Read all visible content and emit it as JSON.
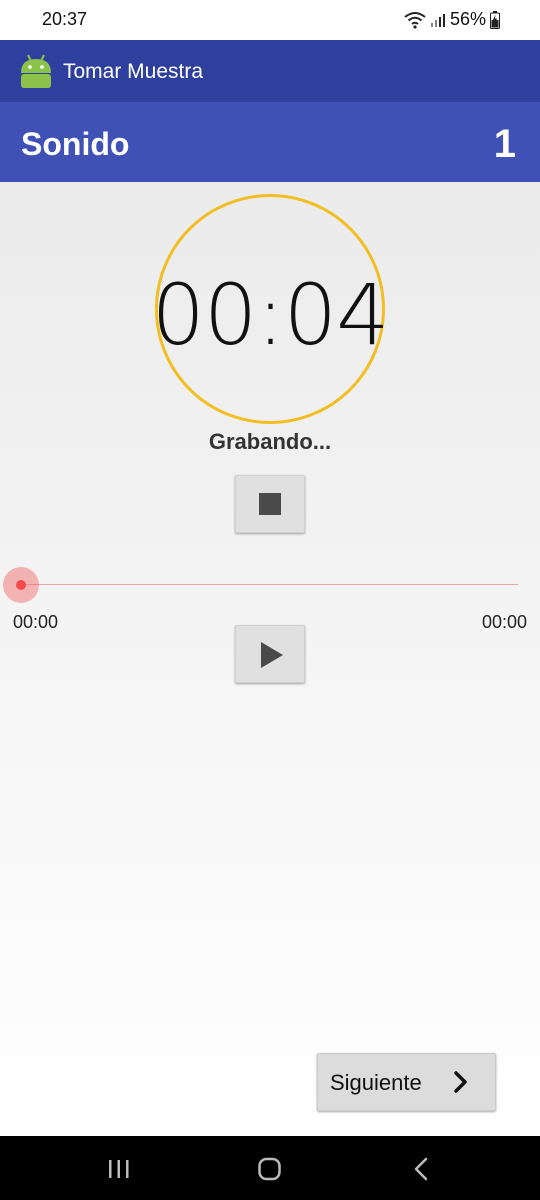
{
  "status_bar": {
    "time": "20:37",
    "battery": "56%",
    "icons": [
      "wifi-icon",
      "signal-icon",
      "battery-icon"
    ]
  },
  "app_bar": {
    "title": "Tomar Muestra",
    "logo_icon": "android-icon"
  },
  "section": {
    "title": "Sonido",
    "number": "1"
  },
  "recorder": {
    "timer": "00:04",
    "status": "Grabando...",
    "stop_icon": "stop-icon",
    "play_icon": "play-icon"
  },
  "player": {
    "position": "00:00",
    "duration": "00:00",
    "progress": 0
  },
  "footer": {
    "next_label": "Siguiente",
    "next_icon": "chevron-right-icon"
  },
  "nav_bar": {
    "icons": [
      "recents-icon",
      "home-icon",
      "back-icon"
    ]
  },
  "colors": {
    "app_bar": "#2e3f9d",
    "section_header": "#3f51b5",
    "timer_ring": "#f2be22",
    "seek_accent": "#f44c4c"
  }
}
